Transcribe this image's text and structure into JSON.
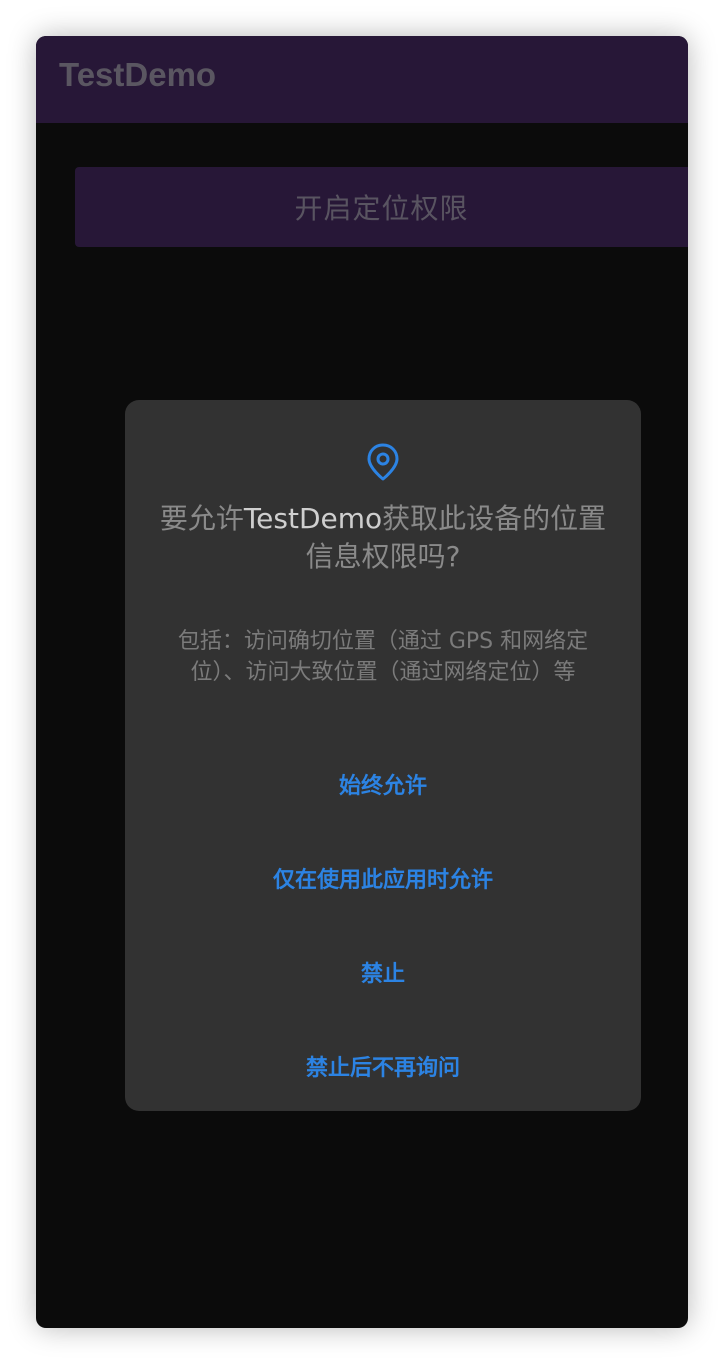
{
  "app_bar": {
    "title": "TestDemo"
  },
  "main": {
    "button_label": "开启定位权限"
  },
  "dialog": {
    "icon": "location-pin-icon",
    "title_prefix": "要允许",
    "title_app_name": "TestDemo",
    "title_suffix": "获取此设备的位置信息权限吗?",
    "description": "包括：访问确切位置（通过 GPS 和网络定位）、访问大致位置（通过网络定位）等",
    "options": [
      "始终允许",
      "仅在使用此应用时允许",
      "禁止",
      "禁止后不再询问"
    ]
  },
  "colors": {
    "app_bar_bg": "#271737",
    "screen_bg": "#0b0b0b",
    "dialog_bg": "#323232",
    "accent": "#2c83e3"
  }
}
